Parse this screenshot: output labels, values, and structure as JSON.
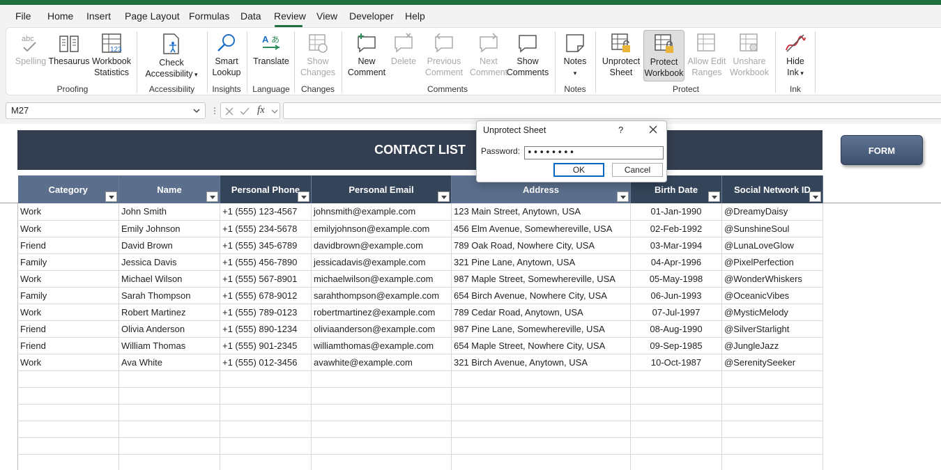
{
  "menu": {
    "items": [
      "File",
      "Home",
      "Insert",
      "Page Layout",
      "Formulas",
      "Data",
      "Review",
      "View",
      "Developer",
      "Help"
    ],
    "active": "Review"
  },
  "ribbon": {
    "proofing": {
      "label": "Proofing",
      "spelling": "Spelling",
      "thesaurus": "Thesaurus",
      "workbook_statistics_1": "Workbook",
      "workbook_statistics_2": "Statistics"
    },
    "accessibility": {
      "label": "Accessibility",
      "check_1": "Check",
      "check_2": "Accessibility"
    },
    "insights": {
      "label": "Insights",
      "smart_1": "Smart",
      "smart_2": "Lookup"
    },
    "language": {
      "label": "Language",
      "translate": "Translate"
    },
    "changes": {
      "label": "Changes",
      "show_1": "Show",
      "show_2": "Changes"
    },
    "comments": {
      "label": "Comments",
      "new_1": "New",
      "new_2": "Comment",
      "delete": "Delete",
      "prev_1": "Previous",
      "prev_2": "Comment",
      "next_1": "Next",
      "next_2": "Comment",
      "showc_1": "Show",
      "showc_2": "Comments"
    },
    "notes": {
      "label": "Notes",
      "notes": "Notes"
    },
    "protect": {
      "label": "Protect",
      "unprotect_1": "Unprotect",
      "unprotect_2": "Sheet",
      "protectwb_1": "Protect",
      "protectwb_2": "Workbook",
      "allow_1": "Allow Edit",
      "allow_2": "Ranges",
      "unshare_1": "Unshare",
      "unshare_2": "Workbook"
    },
    "ink": {
      "label": "Ink",
      "hide_1": "Hide",
      "hide_2": "Ink"
    }
  },
  "formula_bar": {
    "name_box": "M27",
    "fx": "fx",
    "value": ""
  },
  "sheet": {
    "title": "CONTACT LIST",
    "form_button": "FORM",
    "columns": [
      "Category",
      "Name",
      "Personal Phone",
      "Personal Email",
      "Address",
      "Birth Date",
      "Social Network ID"
    ],
    "rows": [
      [
        "Work",
        "John Smith",
        "+1 (555) 123-4567",
        "johnsmith@example.com",
        "123 Main Street, Anytown, USA",
        "01-Jan-1990",
        "@DreamyDaisy"
      ],
      [
        "Work",
        "Emily Johnson",
        "+1 (555) 234-5678",
        "emilyjohnson@example.com",
        "456 Elm Avenue, Somewhereville, USA",
        "02-Feb-1992",
        "@SunshineSoul"
      ],
      [
        "Friend",
        "David Brown",
        "+1 (555) 345-6789",
        "davidbrown@example.com",
        "789 Oak Road, Nowhere City, USA",
        "03-Mar-1994",
        "@LunaLoveGlow"
      ],
      [
        "Family",
        "Jessica Davis",
        "+1 (555) 456-7890",
        "jessicadavis@example.com",
        "321 Pine Lane, Anytown, USA",
        "04-Apr-1996",
        "@PixelPerfection"
      ],
      [
        "Work",
        "Michael Wilson",
        "+1 (555) 567-8901",
        "michaelwilson@example.com",
        "987 Maple Street, Somewhereville, USA",
        "05-May-1998",
        "@WonderWhiskers"
      ],
      [
        "Family",
        "Sarah Thompson",
        "+1 (555) 678-9012",
        "sarahthompson@example.com",
        "654 Birch Avenue, Nowhere City, USA",
        "06-Jun-1993",
        "@OceanicVibes"
      ],
      [
        "Work",
        "Robert Martinez",
        "+1 (555) 789-0123",
        "robertmartinez@example.com",
        "789 Cedar Road, Anytown, USA",
        "07-Jul-1997",
        "@MysticMelody"
      ],
      [
        "Friend",
        "Olivia Anderson",
        "+1 (555) 890-1234",
        "oliviaanderson@example.com",
        "987 Pine Lane, Somewhereville, USA",
        "08-Aug-1990",
        "@SilverStarlight"
      ],
      [
        "Friend",
        "William Thomas",
        "+1 (555) 901-2345",
        "williamthomas@example.com",
        "654 Maple Street, Nowhere City, USA",
        "09-Sep-1985",
        "@JungleJazz"
      ],
      [
        "Work",
        "Ava White",
        "+1 (555) 012-3456",
        "avawhite@example.com",
        "321 Birch Avenue, Anytown, USA",
        "10-Oct-1987",
        "@SerenitySeeker"
      ]
    ]
  },
  "dialog": {
    "title": "Unprotect Sheet",
    "help": "?",
    "password_label": "Password:",
    "password_value": "••••••••",
    "ok": "OK",
    "cancel": "Cancel"
  },
  "colors": {
    "accent": "#1e6e3e",
    "header_blue": "#5b6f8c",
    "banner": "#333f50"
  }
}
